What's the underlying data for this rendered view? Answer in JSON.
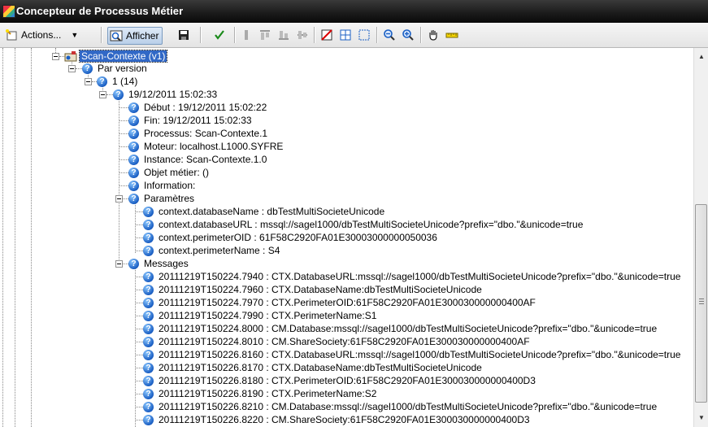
{
  "window": {
    "title": "Concepteur de Processus Métier"
  },
  "toolbar": {
    "actions_label": "Actions...",
    "afficher_label": "Afficher"
  },
  "tree": {
    "root": {
      "label": "Scan-Contexte (v1)"
    },
    "par_version": {
      "label": "Par version"
    },
    "version": {
      "label": "1 (14)"
    },
    "instance_date": {
      "label": "19/12/2011 15:02:33"
    },
    "details": [
      "Début : 19/12/2011 15:02:22",
      "Fin: 19/12/2011 15:02:33",
      "Processus: Scan-Contexte.1",
      "Moteur: localhost.L1000.SYFRE",
      "Instance: Scan-Contexte.1.0",
      "Objet métier:  ()",
      "Information:"
    ],
    "parametres": {
      "label": "Paramètres",
      "items": [
        "context.databaseName : dbTestMultiSocieteUnicode",
        "context.databaseURL : mssql://sagel1000/dbTestMultiSocieteUnicode?prefix=\"dbo.\"&unicode=true",
        "context.perimeterOID : 61F58C2920FA01E30003000000050036",
        "context.perimeterName : S4"
      ]
    },
    "messages": {
      "label": "Messages",
      "items": [
        "20111219T150224.7940 : CTX.DatabaseURL:mssql://sagel1000/dbTestMultiSocieteUnicode?prefix=\"dbo.\"&unicode=true",
        "20111219T150224.7960 : CTX.DatabaseName:dbTestMultiSocieteUnicode",
        "20111219T150224.7970 : CTX.PerimeterOID:61F58C2920FA01E300030000000400AF",
        "20111219T150224.7990 : CTX.PerimeterName:S1",
        "20111219T150224.8000 : CM.Database:mssql://sagel1000/dbTestMultiSocieteUnicode?prefix=\"dbo.\"&unicode=true",
        "20111219T150224.8010 : CM.ShareSociety:61F58C2920FA01E300030000000400AF",
        "20111219T150226.8160 : CTX.DatabaseURL:mssql://sagel1000/dbTestMultiSocieteUnicode?prefix=\"dbo.\"&unicode=true",
        "20111219T150226.8170 : CTX.DatabaseName:dbTestMultiSocieteUnicode",
        "20111219T150226.8180 : CTX.PerimeterOID:61F58C2920FA01E300030000000400D3",
        "20111219T150226.8190 : CTX.PerimeterName:S2",
        "20111219T150226.8210 : CM.Database:mssql://sagel1000/dbTestMultiSocieteUnicode?prefix=\"dbo.\"&unicode=true",
        "20111219T150226.8220 : CM.ShareSociety:61F58C2920FA01E300030000000400D3"
      ]
    }
  }
}
